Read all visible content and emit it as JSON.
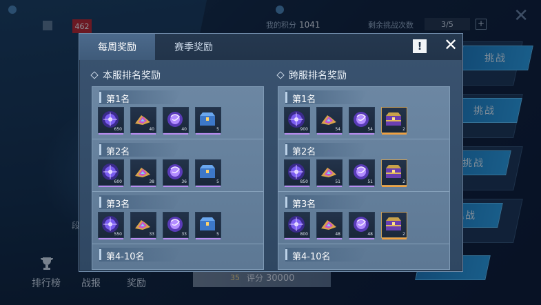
{
  "background": {
    "rank_number": "462",
    "my_points_label": "我的积分",
    "my_points_value": "1041",
    "remaining_label": "剩余挑战次数",
    "remaining_value": "3/5",
    "plus_label": "+",
    "challenge_label": "挑战",
    "side_label": "段",
    "nav": [
      "排行榜",
      "战报",
      "奖励"
    ],
    "level_value": "35",
    "score_label": "评分",
    "score_value": "30000"
  },
  "modal": {
    "tabs": [
      "每周奖励",
      "赛季奖励"
    ],
    "info_label": "!",
    "close_label": "✕",
    "columns": [
      {
        "title": "本服排名奖励",
        "ranks": [
          {
            "label": "第1名",
            "items": [
              {
                "icon": "orb-icon",
                "count": "650"
              },
              {
                "icon": "crystal-icon",
                "count": "40"
              },
              {
                "icon": "swirl-orb-icon",
                "count": "40"
              },
              {
                "icon": "blue-chest-icon",
                "count": "5"
              }
            ]
          },
          {
            "label": "第2名",
            "items": [
              {
                "icon": "orb-icon",
                "count": "600"
              },
              {
                "icon": "crystal-icon",
                "count": "38"
              },
              {
                "icon": "swirl-orb-icon",
                "count": "36"
              },
              {
                "icon": "blue-chest-icon",
                "count": "5"
              }
            ]
          },
          {
            "label": "第3名",
            "items": [
              {
                "icon": "orb-icon",
                "count": "550"
              },
              {
                "icon": "crystal-icon",
                "count": "33"
              },
              {
                "icon": "swirl-orb-icon",
                "count": "33"
              },
              {
                "icon": "blue-chest-icon",
                "count": "5"
              }
            ]
          },
          {
            "label": "第4-10名",
            "items": []
          }
        ]
      },
      {
        "title": "跨服排名奖励",
        "ranks": [
          {
            "label": "第1名",
            "items": [
              {
                "icon": "orb-icon",
                "count": "900"
              },
              {
                "icon": "crystal-icon",
                "count": "54"
              },
              {
                "icon": "swirl-orb-icon",
                "count": "54"
              },
              {
                "icon": "gold-chest-icon",
                "count": "2"
              }
            ]
          },
          {
            "label": "第2名",
            "items": [
              {
                "icon": "orb-icon",
                "count": "850"
              },
              {
                "icon": "crystal-icon",
                "count": "51"
              },
              {
                "icon": "swirl-orb-icon",
                "count": "51"
              },
              {
                "icon": "gold-chest-icon",
                "count": "2"
              }
            ]
          },
          {
            "label": "第3名",
            "items": [
              {
                "icon": "orb-icon",
                "count": "800"
              },
              {
                "icon": "crystal-icon",
                "count": "48"
              },
              {
                "icon": "swirl-orb-icon",
                "count": "48"
              },
              {
                "icon": "gold-chest-icon",
                "count": "2"
              }
            ]
          },
          {
            "label": "第4-10名",
            "items": []
          }
        ]
      }
    ]
  }
}
